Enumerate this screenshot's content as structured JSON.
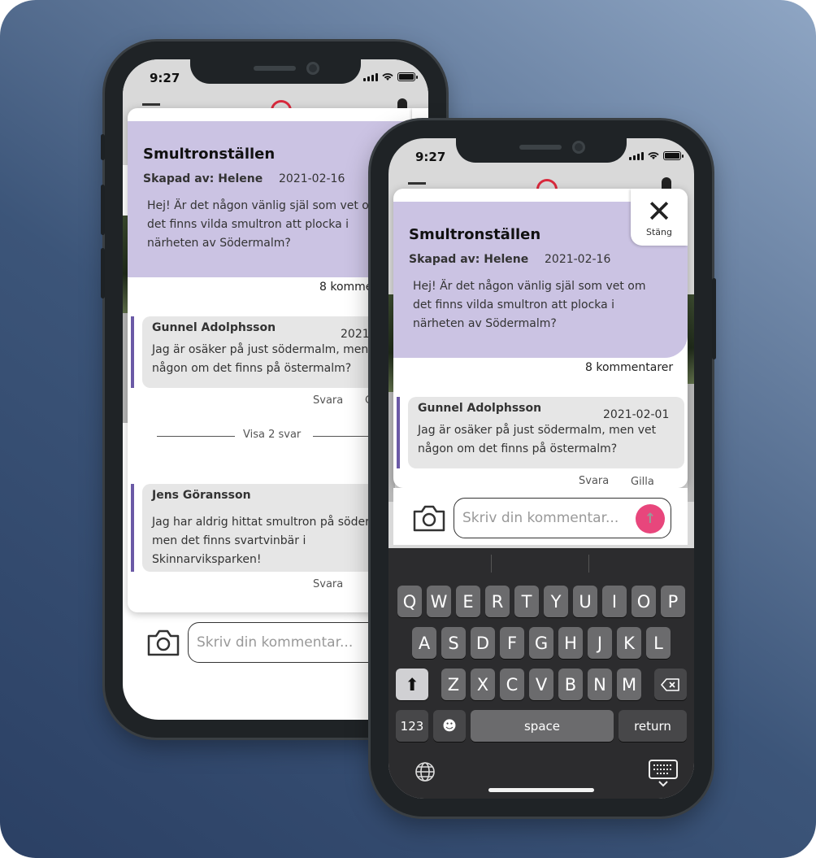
{
  "status_bar": {
    "time": "9:27"
  },
  "post": {
    "title": "Smultronställen",
    "author": "Skapad av: Helene",
    "date": "2021-02-16",
    "body": "Hej! Är det någon vänlig själ som vet om det finns vilda smultron att plocka i närheten av Södermalm?"
  },
  "close": {
    "label": "Stäng",
    "icon": "close-icon"
  },
  "comment_count": "8 kommentarer",
  "comments": [
    {
      "name": "Gunnel Adolphsson",
      "date": "2021-02-01",
      "text": "Jag är osäker på just södermalm, men vet någon om det finns på östermalm?",
      "reply_label": "Svara",
      "like_label": "Gilla"
    },
    {
      "name": "Jens Göransson",
      "text": "Jag har aldrig hittat smultron på söder men det finns svartvinbär i Skinnarviksparken!",
      "reply_label": "Svara"
    }
  ],
  "show_replies": "Visa 2 svar",
  "composer": {
    "placeholder": "Skriv din kommentar...",
    "camera_icon": "camera-icon",
    "send_icon": "arrow-up-icon"
  },
  "keyboard": {
    "row1": [
      "Q",
      "W",
      "E",
      "R",
      "T",
      "Y",
      "U",
      "I",
      "O",
      "P"
    ],
    "row2": [
      "A",
      "S",
      "D",
      "F",
      "G",
      "H",
      "J",
      "K",
      "L"
    ],
    "row3": [
      "Z",
      "X",
      "C",
      "V",
      "B",
      "N",
      "M"
    ],
    "numbers": "123",
    "space": "space",
    "return": "return"
  },
  "colors": {
    "accent": "#cbc3e3",
    "comment_bar": "#6b5aa6",
    "send": "#e8467c"
  }
}
